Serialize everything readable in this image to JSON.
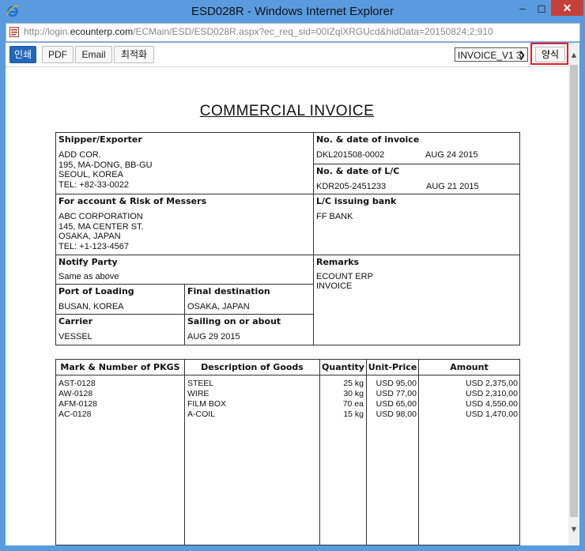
{
  "window": {
    "title": "ESD028R - Windows Internet Explorer",
    "url_prefix": "http://login.",
    "url_host": "ecounterp.com",
    "url_rest": "/ECMain/ESD/ESD028R.aspx?ec_req_sid=00IZqlXRGUcd&hidData=20150824;2;910"
  },
  "toolbar": {
    "print_label": "인쇄",
    "pdf_label": "PDF",
    "email_label": "Email",
    "optimize_label": "최적화",
    "template_selected": "INVOICE_V1 3",
    "form_label": "양식"
  },
  "invoice": {
    "title": "COMMERCIAL INVOICE",
    "shipper_header": "Shipper/Exporter",
    "shipper_lines": [
      "ADD COR.",
      "195, MA-DONG, BB-GU",
      "SEOUL, KOREA",
      "TEL: +82-33-0022"
    ],
    "invoice_no_header": "No. & date of invoice",
    "invoice_no": "DKL201508-0002",
    "invoice_date": "AUG 24 2015",
    "lc_header": "No. & date of L/C",
    "lc_no": "KDR205-2451233",
    "lc_date": "AUG 21 2015",
    "messers_header": "For account & Risk of Messers",
    "messers_lines": [
      "ABC CORPORATION",
      "145, MA CENTER ST.",
      "OSAKA, JAPAN",
      "TEL: +1-123-4567"
    ],
    "lc_bank_header": "L/C issuing bank",
    "lc_bank": "FF BANK",
    "notify_header": "Notify Party",
    "notify": "Same as above",
    "remarks_header": "Remarks",
    "remarks_lines": [
      "ECOUNT ERP",
      "INVOICE"
    ],
    "port_header": "Port of Loading",
    "port": "BUSAN, KOREA",
    "dest_header": "Final destination",
    "dest": "OSAKA, JAPAN",
    "carrier_header": "Carrier",
    "carrier": "VESSEL",
    "sailing_header": "Sailing on or about",
    "sailing": "AUG 29 2015"
  },
  "goods": {
    "headers": [
      "Mark & Number of PKGS",
      "Description of Goods",
      "Quantity",
      "Unit-Price",
      "Amount"
    ],
    "rows": [
      {
        "mark": "AST-0128",
        "desc": "STEEL",
        "qty": "25 kg",
        "price": "USD 95,00",
        "amount": "USD 2,375,00"
      },
      {
        "mark": "AW-0128",
        "desc": "WIRE",
        "qty": "30 kg",
        "price": "USD 77,00",
        "amount": "USD 2,310,00"
      },
      {
        "mark": "AFM-0128",
        "desc": "FILM BOX",
        "qty": "70 ea",
        "price": "USD 65,00",
        "amount": "USD 4,550,00"
      },
      {
        "mark": "AC-0128",
        "desc": "A-COIL",
        "qty": "15 kg",
        "price": "USD 98,00",
        "amount": "USD 1,470,00"
      }
    ]
  }
}
